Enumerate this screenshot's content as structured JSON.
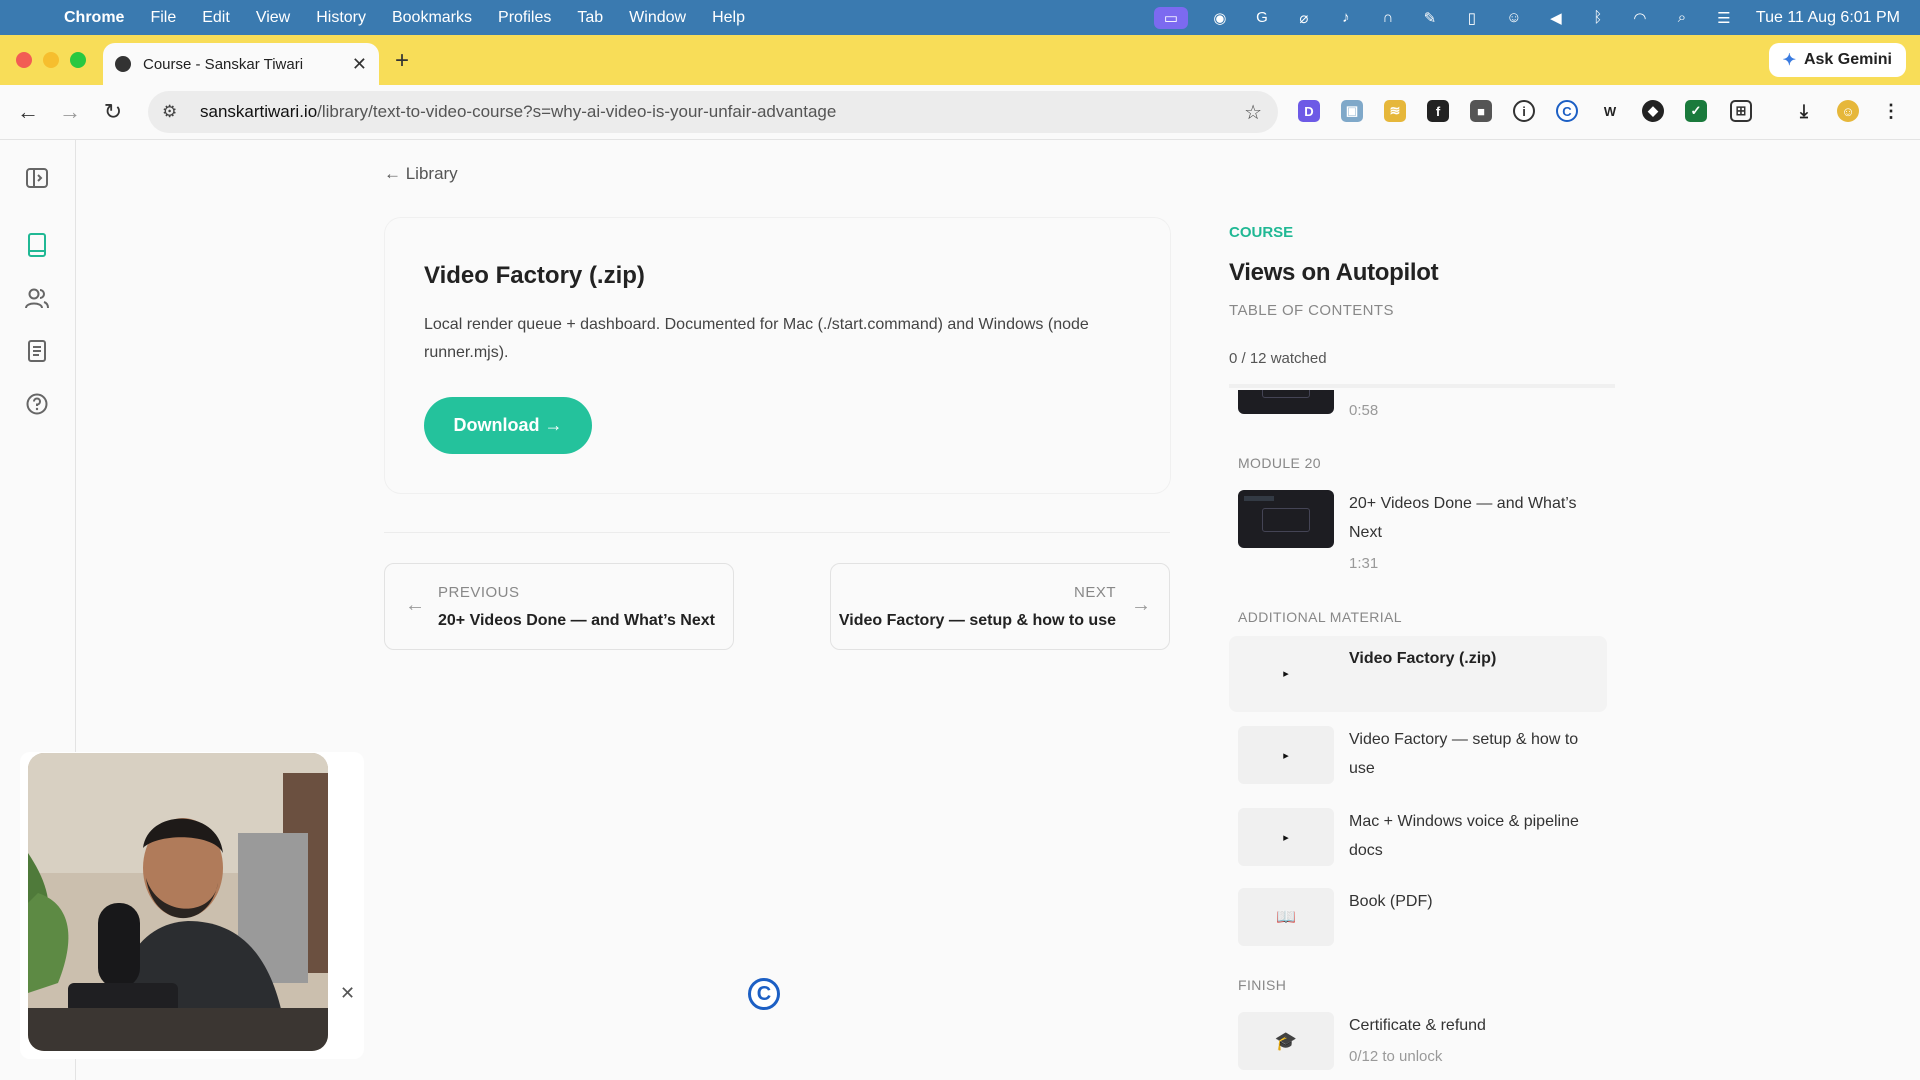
{
  "menubar": {
    "app": "Chrome",
    "items": [
      "File",
      "Edit",
      "View",
      "History",
      "Bookmarks",
      "Profiles",
      "Tab",
      "Window",
      "Help"
    ],
    "clock": "Tue 11 Aug  6:01 PM"
  },
  "browser": {
    "tab_title": "Course - Sanskar Tiwari",
    "ask_gemini": "Ask Gemini",
    "url_host": "sanskartiwari.io",
    "url_path": "/library/text-to-video-course?s=why-ai-video-is-your-unfair-advantage"
  },
  "main": {
    "back_label": "← Library",
    "card_title": "Video Factory (.zip)",
    "card_desc": "Local render queue + dashboard. Documented for Mac (./start.command) and Windows (node runner.mjs).",
    "download_label": "Download →",
    "prev_label": "PREVIOUS",
    "prev_title": "20+ Videos Done — and What’s Next",
    "next_label": "NEXT",
    "next_title": "Video Factory — setup & how to use"
  },
  "panel": {
    "course_label": "COURSE",
    "course_title": "Views on Autopilot",
    "toc_label": "TABLE OF CONTENTS",
    "watched": "0 / 12 watched",
    "partial_duration": "0:58",
    "module_label": "MODULE 20",
    "module_item_title": "20+ Videos Done — and What’s Next",
    "module_item_duration": "1:31",
    "additional_label": "ADDITIONAL MATERIAL",
    "additional": [
      {
        "title": "Video Factory (.zip)",
        "thumb": "▸"
      },
      {
        "title": "Video Factory — setup & how to use",
        "thumb": "▸"
      },
      {
        "title": "Mac + Windows voice & pipeline docs",
        "thumb": "▸"
      },
      {
        "title": "Book (PDF)",
        "thumb": "📖"
      }
    ],
    "finish_label": "FINISH",
    "finish_title": "Certificate & refund",
    "finish_sub": "0/12 to unlock",
    "finish_thumb": "🎓"
  },
  "colors": {
    "accent": "#24c29c",
    "menubar": "#3a7ab0",
    "tabstrip": "#f8dd58"
  }
}
